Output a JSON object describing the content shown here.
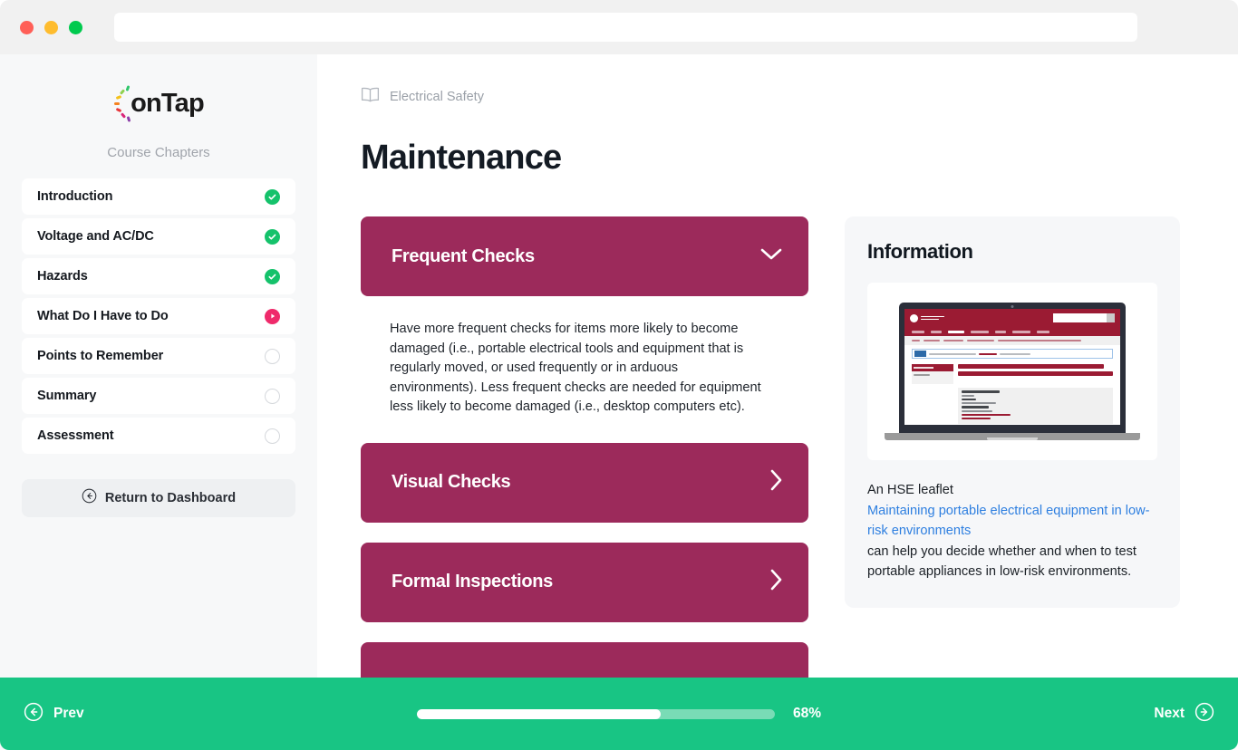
{
  "browser": {
    "traffic_lights": [
      "close",
      "minimize",
      "maximize"
    ],
    "url_value": "",
    "url_placeholder": ""
  },
  "sidebar": {
    "logo_text": "onTap",
    "logo_ray_colors": [
      "#2fc66b",
      "#8fd14f",
      "#f4c21b",
      "#f58220",
      "#e8373c",
      "#d9267a",
      "#8b3fa8"
    ],
    "chapters_heading": "Course Chapters",
    "chapters": [
      {
        "label": "Introduction",
        "status": "done"
      },
      {
        "label": "Voltage and AC/DC",
        "status": "done"
      },
      {
        "label": "Hazards",
        "status": "done"
      },
      {
        "label": "What Do I Have to Do",
        "status": "current"
      },
      {
        "label": "Points to Remember",
        "status": "todo"
      },
      {
        "label": "Summary",
        "status": "todo"
      },
      {
        "label": "Assessment",
        "status": "todo"
      }
    ],
    "return_button": "Return to Dashboard",
    "return_icon": "arrow-left-circle-icon"
  },
  "content": {
    "breadcrumb_icon": "book-icon",
    "breadcrumb": "Electrical Safety",
    "title": "Maintenance",
    "accordions": [
      {
        "title": "Frequent Checks",
        "expanded": true,
        "icon": "chevron-down-icon",
        "body": "Have more frequent checks for items more likely to become damaged (i.e., portable electrical tools and equipment that is regularly moved, or used frequently or in arduous environments). Less frequent checks are needed for equipment less likely to become damaged (i.e., desktop computers etc)."
      },
      {
        "title": "Visual Checks",
        "expanded": false,
        "icon": "chevron-right-icon",
        "body": ""
      },
      {
        "title": "Formal Inspections",
        "expanded": false,
        "icon": "chevron-right-icon",
        "body": ""
      },
      {
        "title": "",
        "expanded": false,
        "icon": "chevron-right-icon",
        "body": ""
      }
    ],
    "accent_color": "#9c2a5b"
  },
  "info": {
    "title": "Information",
    "image_alt": "laptop-hse-webpage-screenshot",
    "screenshot": {
      "heading_line1": "Maintaining portable electric",
      "heading_line2": "equipment in low-risk environments"
    },
    "text_before": "An HSE leaflet",
    "link_text": "Maintaining portable electrical equipment in low-risk environments",
    "text_after": "can help you decide whether and when to test portable appliances in low-risk environments.",
    "link_color": "#2e7fe0"
  },
  "footer": {
    "prev_label": "Prev",
    "prev_icon": "arrow-left-circle-icon",
    "next_label": "Next",
    "next_icon": "arrow-right-circle-icon",
    "progress_percent": 68,
    "progress_label": "68%",
    "bar_color": "#18c584"
  }
}
